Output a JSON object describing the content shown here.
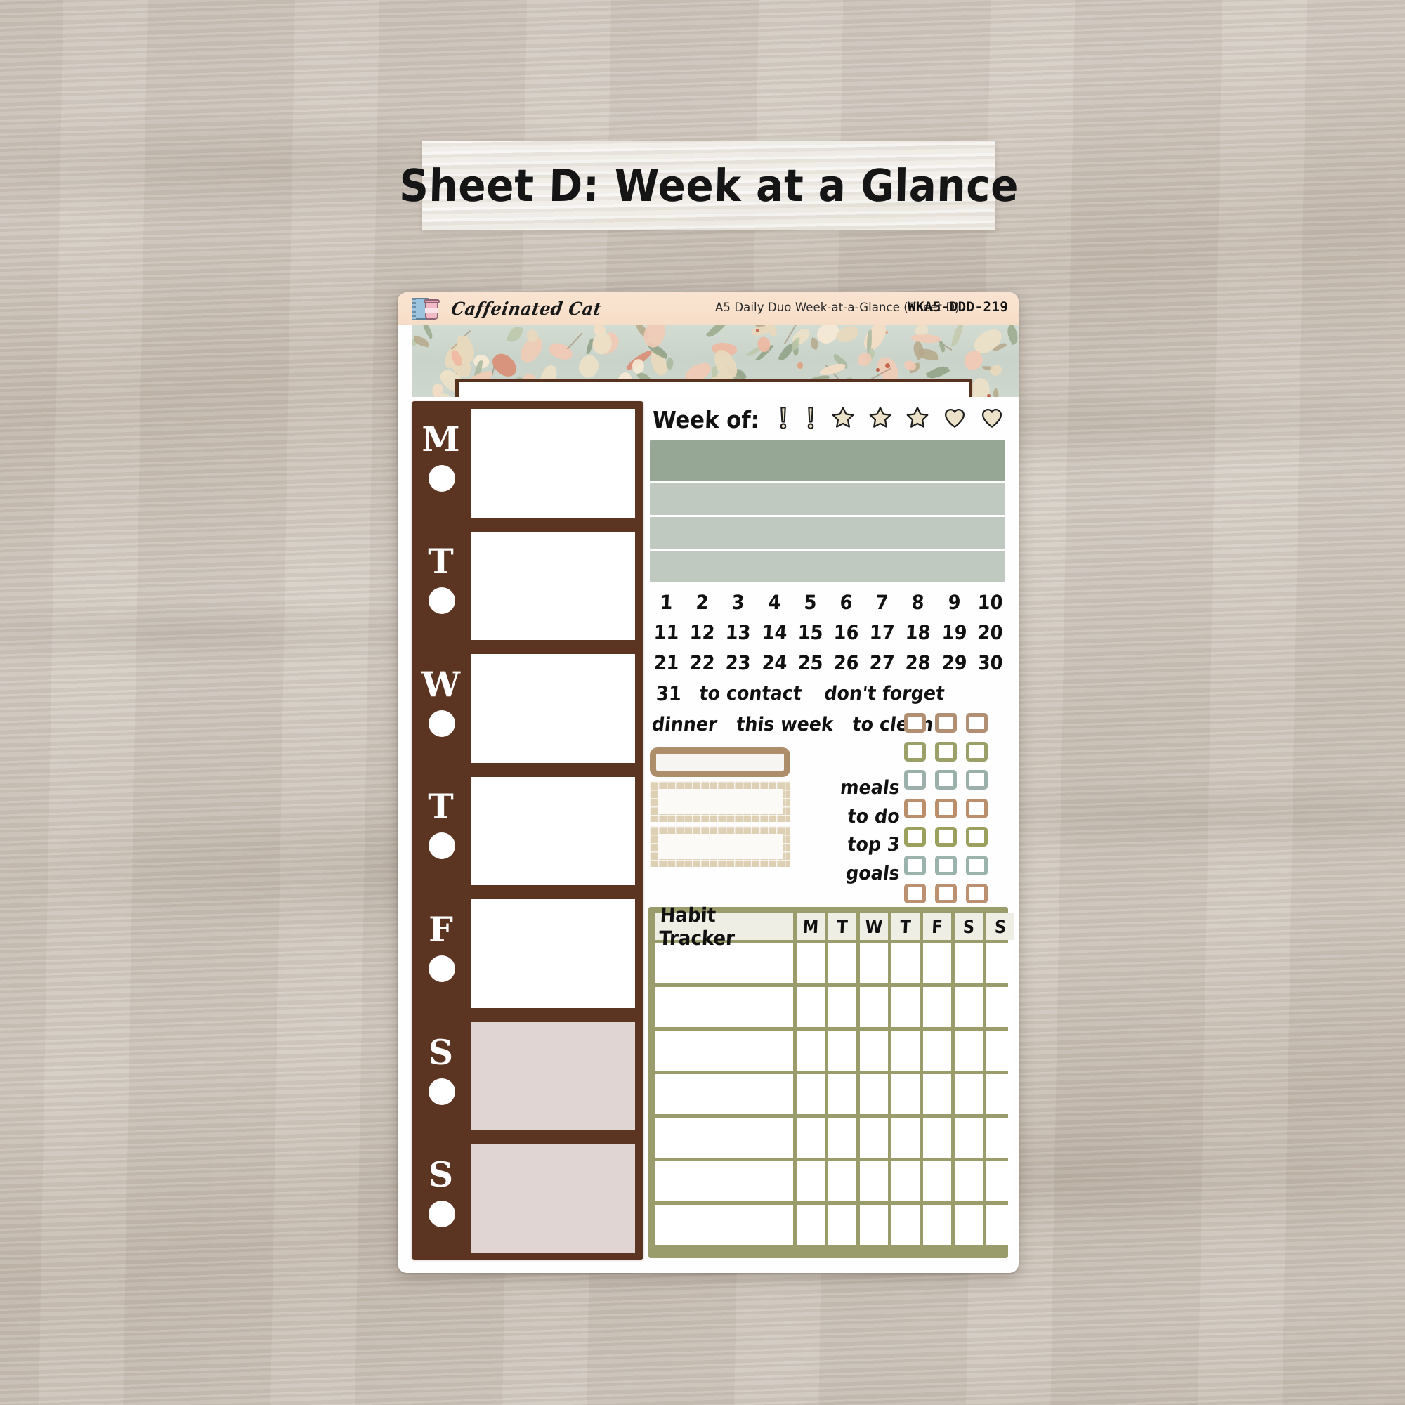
{
  "page": {
    "title_banner": "Sheet D: Week at a Glance"
  },
  "sheet": {
    "brand_name": "Caffeinated Cat",
    "brand_logo_icon": "notebook-coffee-cup-icon",
    "description": "A5 Daily Duo Week-at-a-Glance (Sheet D)",
    "sku": "WKA5-DDD-219",
    "title_box_value": ""
  },
  "day_column": {
    "days": [
      {
        "letter": "M",
        "name": "monday",
        "weekend": false
      },
      {
        "letter": "T",
        "name": "tuesday",
        "weekend": false
      },
      {
        "letter": "W",
        "name": "wednesday",
        "weekend": false
      },
      {
        "letter": "T",
        "name": "thursday",
        "weekend": false
      },
      {
        "letter": "F",
        "name": "friday",
        "weekend": false
      },
      {
        "letter": "S",
        "name": "saturday",
        "weekend": true
      },
      {
        "letter": "S",
        "name": "sunday",
        "weekend": true
      }
    ]
  },
  "week_of": {
    "label": "Week of:",
    "marks": [
      {
        "icon": "exclamation-mark-icon"
      },
      {
        "icon": "exclamation-mark-icon"
      },
      {
        "icon": "star-icon"
      },
      {
        "icon": "star-icon"
      },
      {
        "icon": "star-icon"
      },
      {
        "icon": "heart-icon"
      },
      {
        "icon": "heart-icon"
      }
    ]
  },
  "bars": [
    {
      "color": "#96a795",
      "height": 58
    },
    {
      "color": "#c0c9bf",
      "height": 45
    },
    {
      "color": "#c0c9bf",
      "height": 45
    },
    {
      "color": "#c0c9bf",
      "height": 45
    }
  ],
  "number_grid": {
    "rows": [
      [
        "1",
        "2",
        "3",
        "4",
        "5",
        "6",
        "7",
        "8",
        "9",
        "10"
      ],
      [
        "11",
        "12",
        "13",
        "14",
        "15",
        "16",
        "17",
        "18",
        "19",
        "20"
      ],
      [
        "21",
        "22",
        "23",
        "24",
        "25",
        "26",
        "27",
        "28",
        "29",
        "30"
      ]
    ],
    "last_number": "31"
  },
  "word_stickers": {
    "row1": [
      "to contact",
      "don't forget"
    ],
    "row2": [
      "dinner",
      "this week",
      "to clean"
    ]
  },
  "side_labels": [
    "meals",
    "to do",
    "top 3",
    "goals"
  ],
  "checkbox_grid": {
    "columns": 3,
    "rows": [
      {
        "color": "#b08f72"
      },
      {
        "color": "#9ba069"
      },
      {
        "color": "#9bb0aa"
      },
      {
        "color": "#bb8f6c"
      },
      {
        "color": "#9ba05f"
      },
      {
        "color": "#9cb2ac"
      },
      {
        "color": "#bb9171"
      }
    ]
  },
  "plan_boxes": {
    "top_box": {
      "style": "rounded-tan-frame"
    },
    "mosaic_boxes": [
      {
        "style": "mosaic-tan-frame",
        "height": 58
      },
      {
        "style": "mosaic-tan-frame",
        "height": 58
      }
    ]
  },
  "habit_tracker": {
    "title": "Habit Tracker",
    "days": [
      "M",
      "T",
      "W",
      "T",
      "F",
      "S",
      "S"
    ],
    "body_rows": 7
  },
  "colors": {
    "brand_bar": "#f8e1cd",
    "day_column": "#5c3522",
    "weekend_fill": "#e0d5d2",
    "floral_bg": "#cdd7cd",
    "habit_frame": "#9a9c6c",
    "bar_dark": "#96a795",
    "bar_light": "#c0c9bf"
  }
}
